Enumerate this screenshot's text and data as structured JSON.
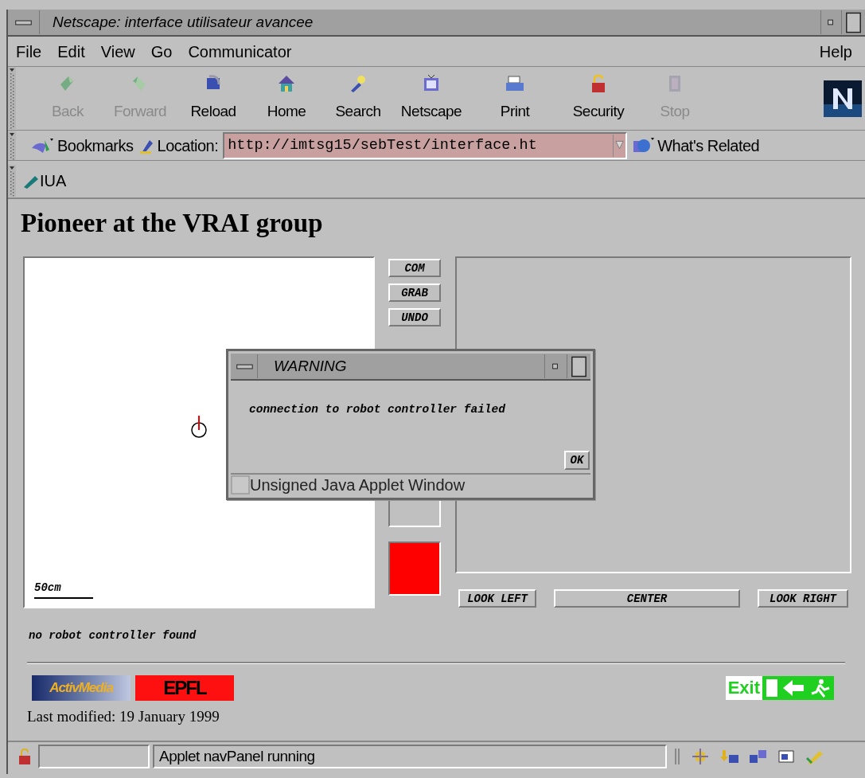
{
  "window": {
    "title": "Netscape: interface utilisateur avancee"
  },
  "menu": {
    "items": [
      "File",
      "Edit",
      "View",
      "Go",
      "Communicator"
    ],
    "help": "Help"
  },
  "toolbar": [
    {
      "label": "Back",
      "disabled": true
    },
    {
      "label": "Forward",
      "disabled": true
    },
    {
      "label": "Reload",
      "disabled": false
    },
    {
      "label": "Home",
      "disabled": false
    },
    {
      "label": "Search",
      "disabled": false
    },
    {
      "label": "Netscape",
      "disabled": false
    },
    {
      "label": "Print",
      "disabled": false
    },
    {
      "label": "Security",
      "disabled": false
    },
    {
      "label": "Stop",
      "disabled": true
    }
  ],
  "location_bar": {
    "bookmarks": "Bookmarks",
    "location_label": "Location:",
    "url": "http://imtsg15/sebTest/interface.ht",
    "related": "What's Related"
  },
  "personal_bar": {
    "items": [
      "IUA"
    ]
  },
  "page": {
    "heading": "Pioneer at the VRAI group",
    "applet": {
      "scale_label": "50cm",
      "side_buttons": [
        "COM",
        "GRAB",
        "UNDO"
      ],
      "look_buttons": [
        "LOOK LEFT",
        "CENTER",
        "LOOK RIGHT"
      ],
      "status": "no robot controller found"
    },
    "logos": {
      "activmedia": "ActivMedia",
      "epfl": "EPFL",
      "exit": "Exit"
    },
    "last_modified": "Last modified: 19 January 1999"
  },
  "dialog": {
    "title": "WARNING",
    "message": "connection to robot controller failed",
    "ok": "OK",
    "footer": "Unsigned Java Applet Window"
  },
  "status_bar": {
    "text": "Applet navPanel running"
  }
}
